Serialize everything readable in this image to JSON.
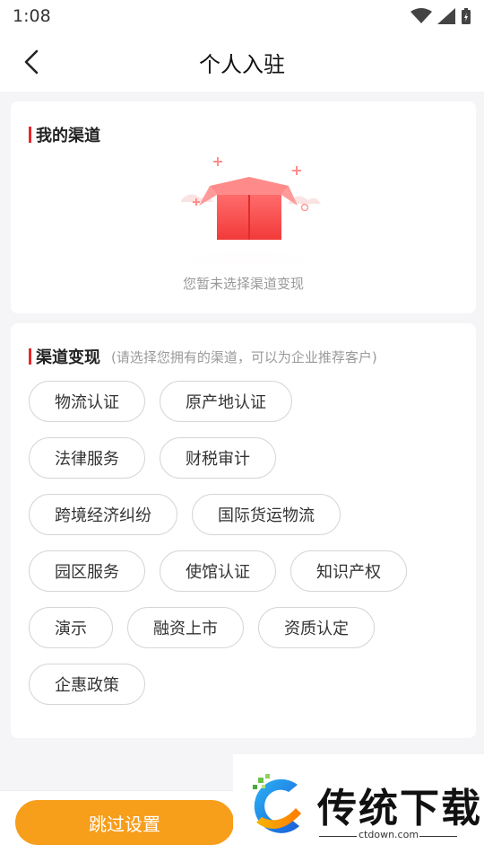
{
  "status_bar": {
    "time": "1:08",
    "icons": [
      "wifi-icon",
      "signal-icon",
      "battery-icon"
    ]
  },
  "header": {
    "title": "个人入驻",
    "back_icon": "chevron-left-icon"
  },
  "my_channel": {
    "title": "我的渠道",
    "empty_text": "您暂未选择渠道变现",
    "illustration": "empty-box-icon"
  },
  "channel_options": {
    "title": "渠道变现",
    "hint": "(请选择您拥有的渠道，可以为企业推荐客户)",
    "rows": [
      [
        "物流认证",
        "原产地认证"
      ],
      [
        "法律服务",
        "财税审计"
      ],
      [
        "跨境经济纠纷",
        "国际货运物流"
      ],
      [
        "园区服务",
        "使馆认证",
        "知识产权"
      ],
      [
        "演示",
        "融资上市",
        "资质认定"
      ],
      [
        "企惠政策"
      ]
    ]
  },
  "footer": {
    "skip_label": "跳过设置"
  },
  "watermark": {
    "title": "传统下载",
    "url": "ctdown.com"
  },
  "colors": {
    "accent_red": "#e8262b",
    "button_orange": "#f79e1b",
    "background": "#f5f5f7"
  }
}
